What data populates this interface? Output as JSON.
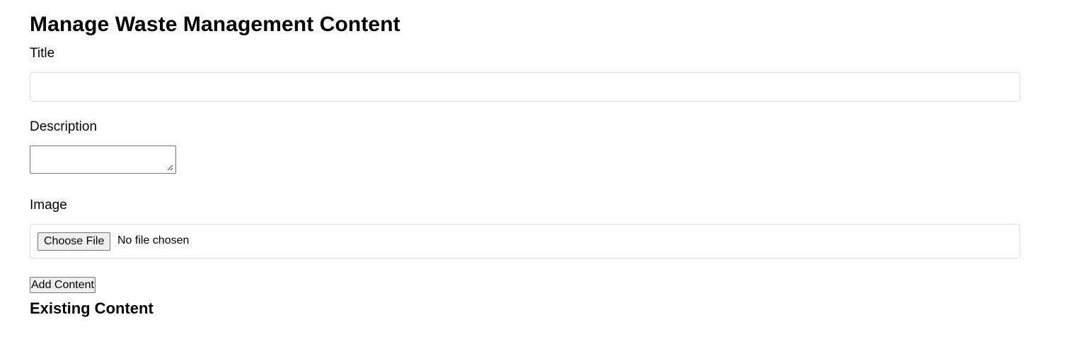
{
  "page": {
    "title": "Manage Waste Management Content"
  },
  "form": {
    "title_label": "Title",
    "title_value": "",
    "description_label": "Description",
    "description_value": "",
    "image_label": "Image",
    "choose_file_label": "Choose File",
    "file_status": "No file chosen",
    "submit_label": "Add Content"
  },
  "existing": {
    "heading": "Existing Content"
  }
}
